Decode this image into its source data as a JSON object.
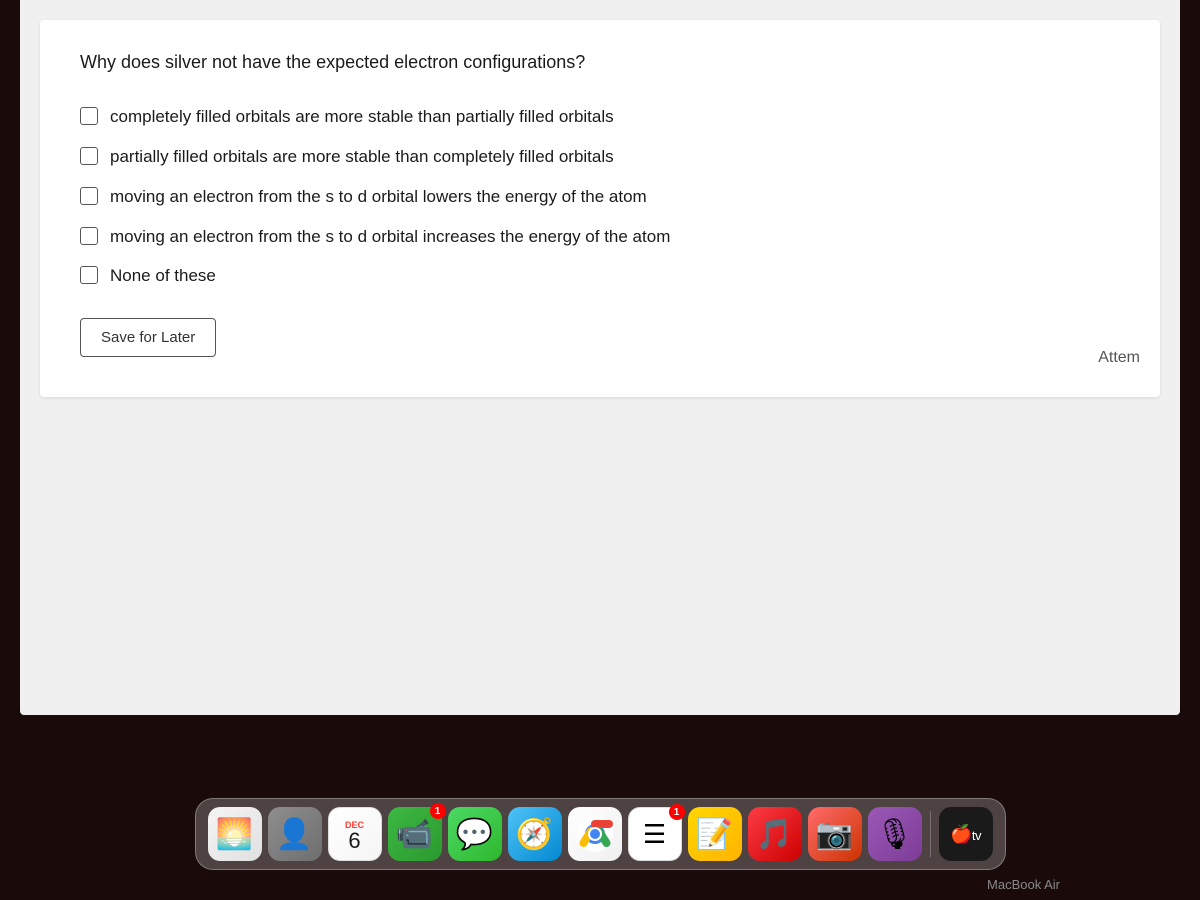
{
  "question": {
    "text": "Why does silver not have the expected electron configurations?",
    "options": [
      {
        "id": "opt1",
        "label": "completely filled orbitals are more stable than partially filled orbitals",
        "checked": false
      },
      {
        "id": "opt2",
        "label": "partially filled orbitals are more stable than completely filled orbitals",
        "checked": false
      },
      {
        "id": "opt3",
        "label": "moving an electron from the s to d orbital lowers the energy of the atom",
        "checked": false
      },
      {
        "id": "opt4",
        "label": "moving an electron from the s to d orbital increases the energy of the atom",
        "checked": false
      },
      {
        "id": "opt5",
        "label": "None of these",
        "checked": false
      }
    ],
    "save_button_label": "Save for Later",
    "attempt_label": "Attem"
  },
  "dock": {
    "apps": [
      {
        "name": "Photos",
        "emoji": "🌅",
        "class": "app-photos",
        "badge": null
      },
      {
        "name": "Contacts",
        "emoji": "👤",
        "class": "app-contacts",
        "badge": null
      },
      {
        "name": "Calendar",
        "class": "app-calendar",
        "special": "calendar",
        "month": "DEC",
        "day": "6",
        "badge": null
      },
      {
        "name": "FaceTime",
        "emoji": "📹",
        "class": "app-facetime",
        "badge": "1"
      },
      {
        "name": "Messages",
        "emoji": "💬",
        "class": "app-messages",
        "badge": null
      },
      {
        "name": "Safari",
        "emoji": "🧭",
        "class": "app-safari",
        "badge": null
      },
      {
        "name": "Chrome",
        "class": "app-chrome",
        "special": "chrome",
        "badge": null
      },
      {
        "name": "Reminders",
        "class": "app-reminders",
        "special": "reminders",
        "badge": "1"
      },
      {
        "name": "Notes",
        "emoji": "📝",
        "class": "app-notes",
        "badge": null
      },
      {
        "name": "Music",
        "emoji": "🎵",
        "class": "app-music",
        "badge": null
      },
      {
        "name": "PhotoBooth",
        "emoji": "📷",
        "class": "app-photos-app",
        "badge": null
      },
      {
        "name": "Podcasts",
        "emoji": "🎙",
        "class": "app-podcasts",
        "badge": null
      },
      {
        "name": "AppleTV",
        "text": "tv",
        "class": "app-apple-tv",
        "badge": null
      }
    ],
    "macbook_label": "MacBook Air"
  }
}
